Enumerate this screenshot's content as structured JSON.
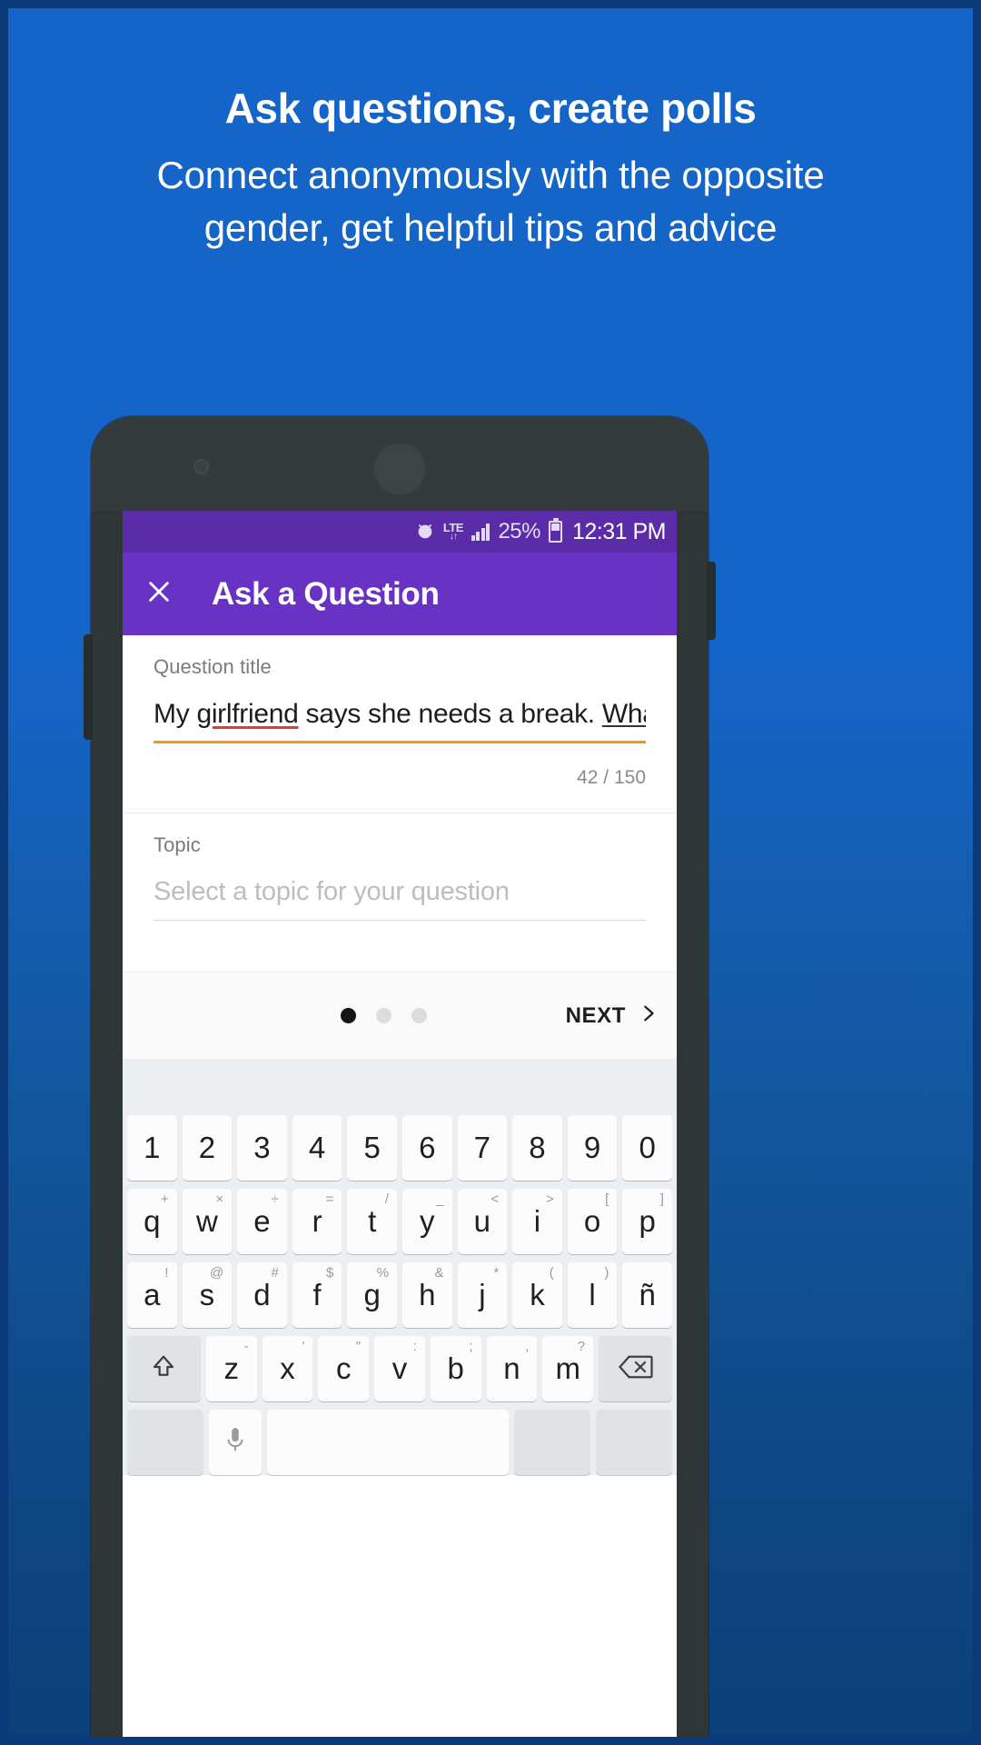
{
  "promo": {
    "title": "Ask questions, create polls",
    "subtitle": "Connect anonymously with the opposite gender, get helpful tips and advice",
    "background_color": "#1565c8"
  },
  "statusbar": {
    "alarm_icon": "alarm-icon",
    "network_label": "LTE",
    "network_arrows": "↓↑",
    "signal_icon": "signal-bars-icon",
    "battery_percent": "25%",
    "battery_icon": "battery-icon",
    "time": "12:31 PM",
    "background_color": "#5a2ca8"
  },
  "appbar": {
    "close_icon": "close-icon",
    "title": "Ask a Question",
    "background_color": "#6833c4"
  },
  "form": {
    "question": {
      "label": "Question title",
      "value_part1": "My ",
      "value_misspelled": "girlfriend",
      "value_part2": " says she needs a break. ",
      "value_cursor_word": "What",
      "full_value": "My girlfriend says she needs a break. What",
      "underline_color": "#f09819",
      "spellcheck_color": "#e53935",
      "counter": "42 / 150"
    },
    "topic": {
      "label": "Topic",
      "placeholder": "Select a topic for your question",
      "value": ""
    }
  },
  "footer": {
    "dots": [
      {
        "active": true
      },
      {
        "active": false
      },
      {
        "active": false
      }
    ],
    "next_label": "NEXT",
    "next_icon": "chevron-right-icon"
  },
  "keyboard": {
    "rows": [
      [
        {
          "main": "1",
          "sup": ""
        },
        {
          "main": "2",
          "sup": ""
        },
        {
          "main": "3",
          "sup": ""
        },
        {
          "main": "4",
          "sup": ""
        },
        {
          "main": "5",
          "sup": ""
        },
        {
          "main": "6",
          "sup": ""
        },
        {
          "main": "7",
          "sup": ""
        },
        {
          "main": "8",
          "sup": ""
        },
        {
          "main": "9",
          "sup": ""
        },
        {
          "main": "0",
          "sup": ""
        }
      ],
      [
        {
          "main": "q",
          "sup": "+"
        },
        {
          "main": "w",
          "sup": "×"
        },
        {
          "main": "e",
          "sup": "÷"
        },
        {
          "main": "r",
          "sup": "="
        },
        {
          "main": "t",
          "sup": "/"
        },
        {
          "main": "y",
          "sup": "_"
        },
        {
          "main": "u",
          "sup": "<"
        },
        {
          "main": "i",
          "sup": ">"
        },
        {
          "main": "o",
          "sup": "["
        },
        {
          "main": "p",
          "sup": "]"
        }
      ],
      [
        {
          "main": "a",
          "sup": "!"
        },
        {
          "main": "s",
          "sup": "@"
        },
        {
          "main": "d",
          "sup": "#"
        },
        {
          "main": "f",
          "sup": "$"
        },
        {
          "main": "g",
          "sup": "%"
        },
        {
          "main": "h",
          "sup": "&"
        },
        {
          "main": "j",
          "sup": "*"
        },
        {
          "main": "k",
          "sup": "("
        },
        {
          "main": "l",
          "sup": ")"
        },
        {
          "main": "ñ",
          "sup": ""
        }
      ],
      [
        {
          "main": "",
          "sup": "",
          "icon": "shift-icon"
        },
        {
          "main": "z",
          "sup": "-"
        },
        {
          "main": "x",
          "sup": "'"
        },
        {
          "main": "c",
          "sup": "\""
        },
        {
          "main": "v",
          "sup": ":"
        },
        {
          "main": "b",
          "sup": ";"
        },
        {
          "main": "n",
          "sup": ","
        },
        {
          "main": "m",
          "sup": "?"
        },
        {
          "main": "",
          "sup": "",
          "icon": "backspace-icon"
        }
      ]
    ]
  }
}
